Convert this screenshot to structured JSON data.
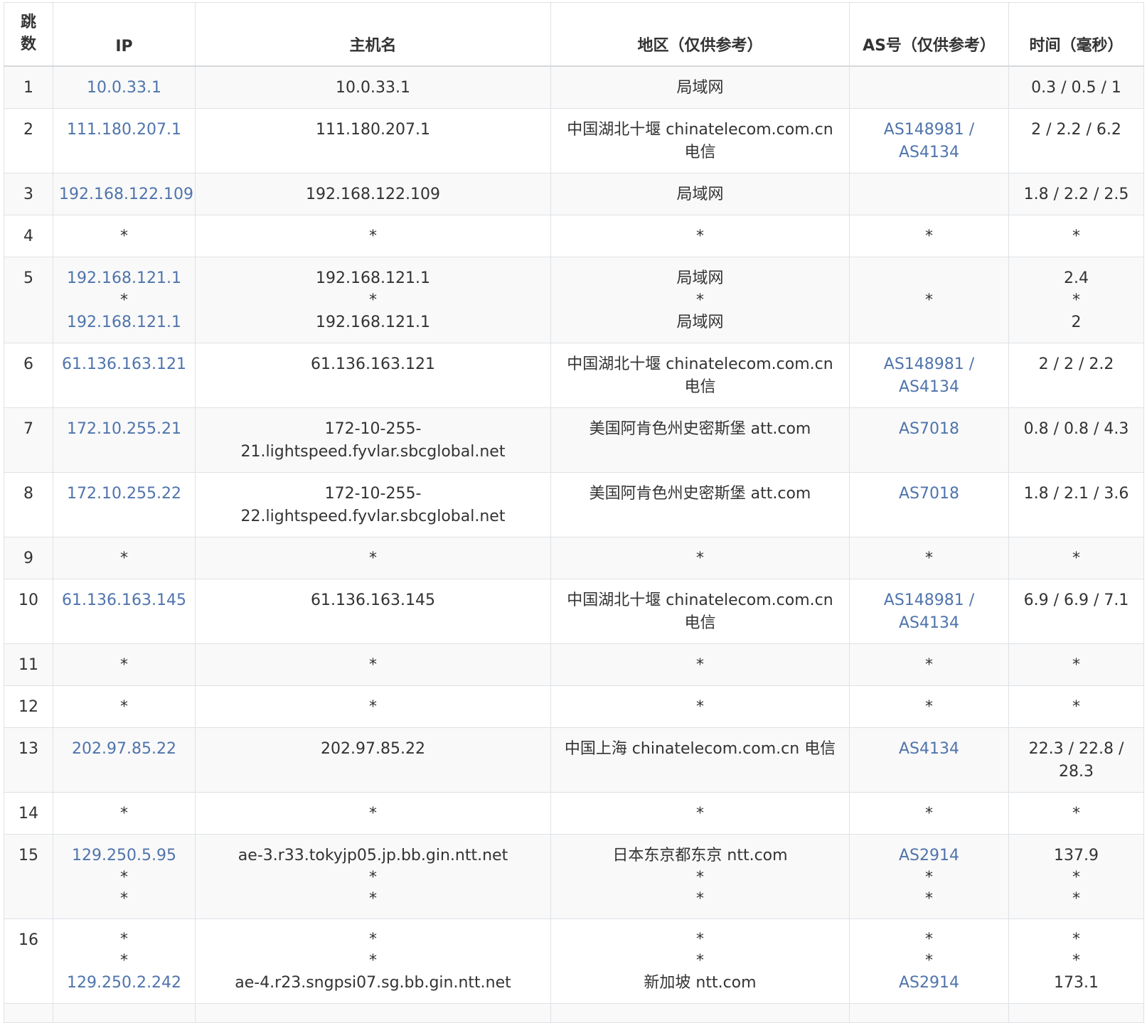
{
  "headers": [
    "跳\n数",
    "IP",
    "主机名",
    "地区（仅供参考）",
    "AS号（仅供参考）",
    "时间（毫秒）"
  ],
  "header_hop_lines": [
    "跳",
    "数"
  ],
  "rows": [
    {
      "hop": "1",
      "ip": [
        "10.0.33.1"
      ],
      "host": [
        "10.0.33.1"
      ],
      "region": [
        "局域网"
      ],
      "as": [
        ""
      ],
      "time": [
        "0.3 / 0.5 / 1"
      ]
    },
    {
      "hop": "2",
      "ip": [
        "111.180.207.1"
      ],
      "host": [
        "111.180.207.1"
      ],
      "region": [
        "中国湖北十堰 chinatelecom.com.cn 电信"
      ],
      "as": [
        "AS148981 / AS4134"
      ],
      "time": [
        "2 / 2.2 / 6.2"
      ]
    },
    {
      "hop": "3",
      "ip": [
        "192.168.122.109"
      ],
      "host": [
        "192.168.122.109"
      ],
      "region": [
        "局域网"
      ],
      "as": [
        ""
      ],
      "time": [
        "1.8 / 2.2 / 2.5"
      ]
    },
    {
      "hop": "4",
      "ip": [
        "*"
      ],
      "host": [
        "*"
      ],
      "region": [
        "*"
      ],
      "as": [
        "*"
      ],
      "time": [
        "*"
      ]
    },
    {
      "hop": "5",
      "ip": [
        "192.168.121.1",
        "*",
        "192.168.121.1"
      ],
      "host": [
        "192.168.121.1",
        "*",
        "192.168.121.1"
      ],
      "region": [
        "局域网",
        "*",
        "局域网"
      ],
      "as": [
        "",
        "*",
        ""
      ],
      "time": [
        "2.4",
        "*",
        "2"
      ]
    },
    {
      "hop": "6",
      "ip": [
        "61.136.163.121"
      ],
      "host": [
        "61.136.163.121"
      ],
      "region": [
        "中国湖北十堰 chinatelecom.com.cn 电信"
      ],
      "as": [
        "AS148981 / AS4134"
      ],
      "time": [
        "2 / 2 / 2.2"
      ]
    },
    {
      "hop": "7",
      "ip": [
        "172.10.255.21"
      ],
      "host": [
        "172-10-255-21.lightspeed.fyvlar.sbcglobal.net"
      ],
      "region": [
        "美国阿肯色州史密斯堡 att.com"
      ],
      "as": [
        "AS7018"
      ],
      "time": [
        "0.8 / 0.8 / 4.3"
      ]
    },
    {
      "hop": "8",
      "ip": [
        "172.10.255.22"
      ],
      "host": [
        "172-10-255-22.lightspeed.fyvlar.sbcglobal.net"
      ],
      "region": [
        "美国阿肯色州史密斯堡 att.com"
      ],
      "as": [
        "AS7018"
      ],
      "time": [
        "1.8 / 2.1 / 3.6"
      ]
    },
    {
      "hop": "9",
      "ip": [
        "*"
      ],
      "host": [
        "*"
      ],
      "region": [
        "*"
      ],
      "as": [
        "*"
      ],
      "time": [
        "*"
      ]
    },
    {
      "hop": "10",
      "ip": [
        "61.136.163.145"
      ],
      "host": [
        "61.136.163.145"
      ],
      "region": [
        "中国湖北十堰 chinatelecom.com.cn 电信"
      ],
      "as": [
        "AS148981 / AS4134"
      ],
      "time": [
        "6.9 / 6.9 / 7.1"
      ]
    },
    {
      "hop": "11",
      "ip": [
        "*"
      ],
      "host": [
        "*"
      ],
      "region": [
        "*"
      ],
      "as": [
        "*"
      ],
      "time": [
        "*"
      ]
    },
    {
      "hop": "12",
      "ip": [
        "*"
      ],
      "host": [
        "*"
      ],
      "region": [
        "*"
      ],
      "as": [
        "*"
      ],
      "time": [
        "*"
      ]
    },
    {
      "hop": "13",
      "ip": [
        "202.97.85.22"
      ],
      "host": [
        "202.97.85.22"
      ],
      "region": [
        "中国上海 chinatelecom.com.cn 电信"
      ],
      "as": [
        "AS4134"
      ],
      "time": [
        "22.3 / 22.8 / 28.3"
      ]
    },
    {
      "hop": "14",
      "ip": [
        "*"
      ],
      "host": [
        "*"
      ],
      "region": [
        "*"
      ],
      "as": [
        "*"
      ],
      "time": [
        "*"
      ]
    },
    {
      "hop": "15",
      "ip": [
        "129.250.5.95",
        "*",
        "*"
      ],
      "host": [
        "ae-3.r33.tokyjp05.jp.bb.gin.ntt.net",
        "*",
        "*"
      ],
      "region": [
        "日本东京都东京 ntt.com",
        "*",
        "*"
      ],
      "as": [
        "AS2914",
        "*",
        "*"
      ],
      "time": [
        "137.9",
        "*",
        "*"
      ]
    },
    {
      "hop": "16",
      "ip": [
        "*",
        "*",
        "129.250.2.242"
      ],
      "host": [
        "*",
        "*",
        "ae-4.r23.sngpsi07.sg.bb.gin.ntt.net"
      ],
      "region": [
        "*",
        "*",
        "新加坡 ntt.com"
      ],
      "as": [
        "*",
        "*",
        "AS2914"
      ],
      "time": [
        "*",
        "*",
        "173.1"
      ]
    },
    {
      "hop": "",
      "ip": [
        ""
      ],
      "host": [
        ""
      ],
      "region": [
        ""
      ],
      "as": [
        ""
      ],
      "time": [
        ""
      ]
    }
  ],
  "colors": {
    "link": "#4f74ac",
    "text": "#333333",
    "border": "#dee2e6",
    "stripe": "#f9f9f9"
  }
}
